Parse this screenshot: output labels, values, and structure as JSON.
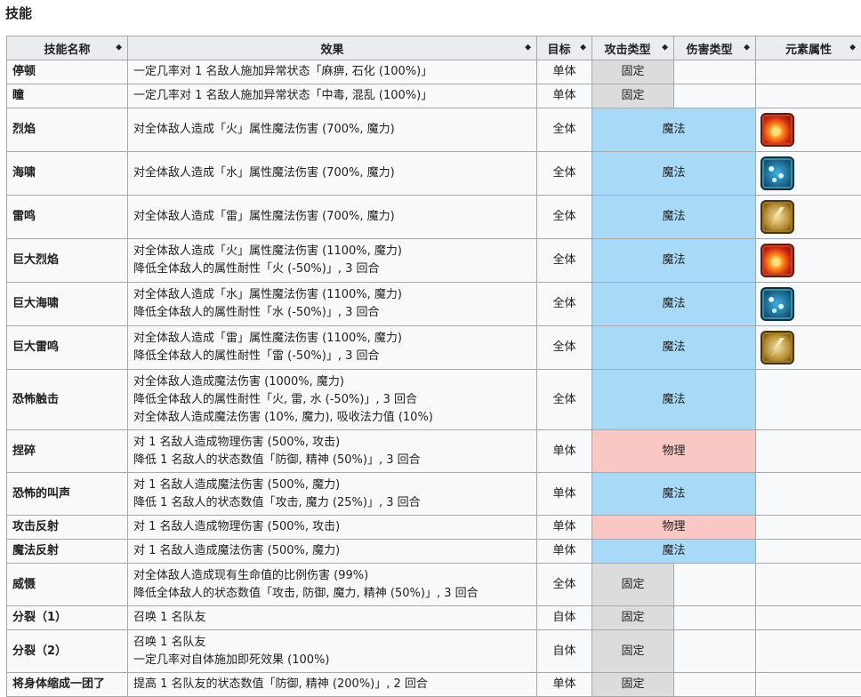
{
  "section_title": "技能",
  "headers": [
    {
      "label": "技能名称"
    },
    {
      "label": "效果"
    },
    {
      "label": "目标"
    },
    {
      "label": "攻击类型"
    },
    {
      "label": "伤害类型"
    },
    {
      "label": "元素属性"
    }
  ],
  "sort_glyph": "◆",
  "rows": [
    {
      "name": "停顿",
      "effect": [
        "一定几率对 1 名敌人施加异常状态「麻痹, 石化 (100%)」"
      ],
      "target": "单体",
      "attack": "固定",
      "damage": "",
      "element": ""
    },
    {
      "name": "瞳",
      "effect": [
        "一定几率对 1 名敌人施加异常状态「中毒, 混乱 (100%)」"
      ],
      "target": "单体",
      "attack": "固定",
      "damage": "",
      "element": ""
    },
    {
      "name": "烈焰",
      "effect": [
        "对全体敌人造成「火」属性魔法伤害 (700%, 魔力)"
      ],
      "target": "全体",
      "merged": "魔法",
      "element": "fire-icon"
    },
    {
      "name": "海啸",
      "effect": [
        "对全体敌人造成「水」属性魔法伤害 (700%, 魔力)"
      ],
      "target": "全体",
      "merged": "魔法",
      "element": "water-icon"
    },
    {
      "name": "雷鸣",
      "effect": [
        "对全体敌人造成「雷」属性魔法伤害 (700%, 魔力)"
      ],
      "target": "全体",
      "merged": "魔法",
      "element": "thunder-icon"
    },
    {
      "name": "巨大烈焰",
      "effect": [
        "对全体敌人造成「火」属性魔法伤害 (1100%, 魔力)",
        "降低全体敌人的属性耐性「火 (-50%)」, 3 回合"
      ],
      "target": "全体",
      "merged": "魔法",
      "element": "fire-icon"
    },
    {
      "name": "巨大海啸",
      "effect": [
        "对全体敌人造成「水」属性魔法伤害 (1100%, 魔力)",
        "降低全体敌人的属性耐性「水 (-50%)」, 3 回合"
      ],
      "target": "全体",
      "merged": "魔法",
      "element": "water-icon"
    },
    {
      "name": "巨大雷鸣",
      "effect": [
        "对全体敌人造成「雷」属性魔法伤害 (1100%, 魔力)",
        "降低全体敌人的属性耐性「雷 (-50%)」, 3 回合"
      ],
      "target": "全体",
      "merged": "魔法",
      "element": "thunder-icon"
    },
    {
      "name": "恐怖触击",
      "effect": [
        "对全体敌人造成魔法伤害 (1000%, 魔力)",
        "降低全体敌人的属性耐性「火, 雷, 水 (-50%)」, 3 回合",
        "对全体敌人造成魔法伤害 (10%, 魔力), 吸收法力值 (10%)"
      ],
      "target": "全体",
      "merged": "魔法",
      "element": ""
    },
    {
      "name": "捏碎",
      "effect": [
        "对 1 名敌人造成物理伤害 (500%, 攻击)",
        "降低 1 名敌人的状态数值「防御, 精神 (50%)」, 3 回合"
      ],
      "target": "单体",
      "merged": "物理",
      "element": ""
    },
    {
      "name": "恐怖的叫声",
      "effect": [
        "对 1 名敌人造成魔法伤害 (500%, 魔力)",
        "降低 1 名敌人的状态数值「攻击, 魔力 (25%)」, 3 回合"
      ],
      "target": "单体",
      "merged": "魔法",
      "element": ""
    },
    {
      "name": "攻击反射",
      "effect": [
        "对 1 名敌人造成物理伤害 (500%, 攻击)"
      ],
      "target": "单体",
      "merged": "物理",
      "element": ""
    },
    {
      "name": "魔法反射",
      "effect": [
        "对 1 名敌人造成魔法伤害 (500%, 魔力)"
      ],
      "target": "单体",
      "merged": "魔法",
      "element": ""
    },
    {
      "name": "威慑",
      "effect": [
        "对全体敌人造成现有生命值的比例伤害 (99%)",
        "降低全体敌人的状态数值「攻击, 防御, 魔力, 精神 (50%)」, 3 回合"
      ],
      "target": "全体",
      "attack": "固定",
      "damage": "",
      "element": ""
    },
    {
      "name": "分裂（1）",
      "effect": [
        "召唤 1 名队友"
      ],
      "target": "自体",
      "attack": "固定",
      "damage": "",
      "element": ""
    },
    {
      "name": "分裂（2）",
      "effect": [
        "召唤 1 名队友",
        "一定几率对自体施加即死效果 (100%)"
      ],
      "target": "自体",
      "attack": "固定",
      "damage": "",
      "element": ""
    },
    {
      "name": "将身体缩成一团了",
      "effect": [
        "提高 1 名队友的状态数值「防御, 精神 (200%)」, 2 回合"
      ],
      "target": "单体",
      "attack": "固定",
      "damage": "",
      "element": ""
    }
  ]
}
